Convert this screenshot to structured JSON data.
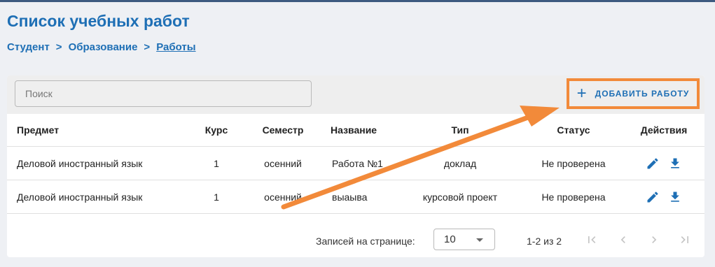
{
  "header": {
    "title": "Список учебных работ",
    "breadcrumb": [
      "Студент",
      ">",
      "Образование",
      ">",
      "Работы"
    ]
  },
  "toolbar": {
    "search_placeholder": "Поиск",
    "add_label": "ДОБАВИТЬ РАБОТУ",
    "add_icon": "plus-icon"
  },
  "table": {
    "columns": [
      "Предмет",
      "Курс",
      "Семестр",
      "Название",
      "Тип",
      "Статус",
      "Действия"
    ],
    "rows": [
      [
        "Деловой иностранный язык",
        "1",
        "осенний",
        "Работа №1",
        "доклад",
        "Не проверена"
      ],
      [
        "Деловой иностранный язык",
        "1",
        "осенний",
        "выаыва",
        "курсовой проект",
        "Не проверена"
      ]
    ],
    "row_actions": [
      "edit-icon",
      "download-icon"
    ]
  },
  "pagination": {
    "rows_per_page_label": "Записей на странице:",
    "rows_per_page": "10",
    "range": "1-2 из 2"
  },
  "colors": {
    "accent": "#1e6fb5",
    "highlight": "#f28a3a"
  }
}
